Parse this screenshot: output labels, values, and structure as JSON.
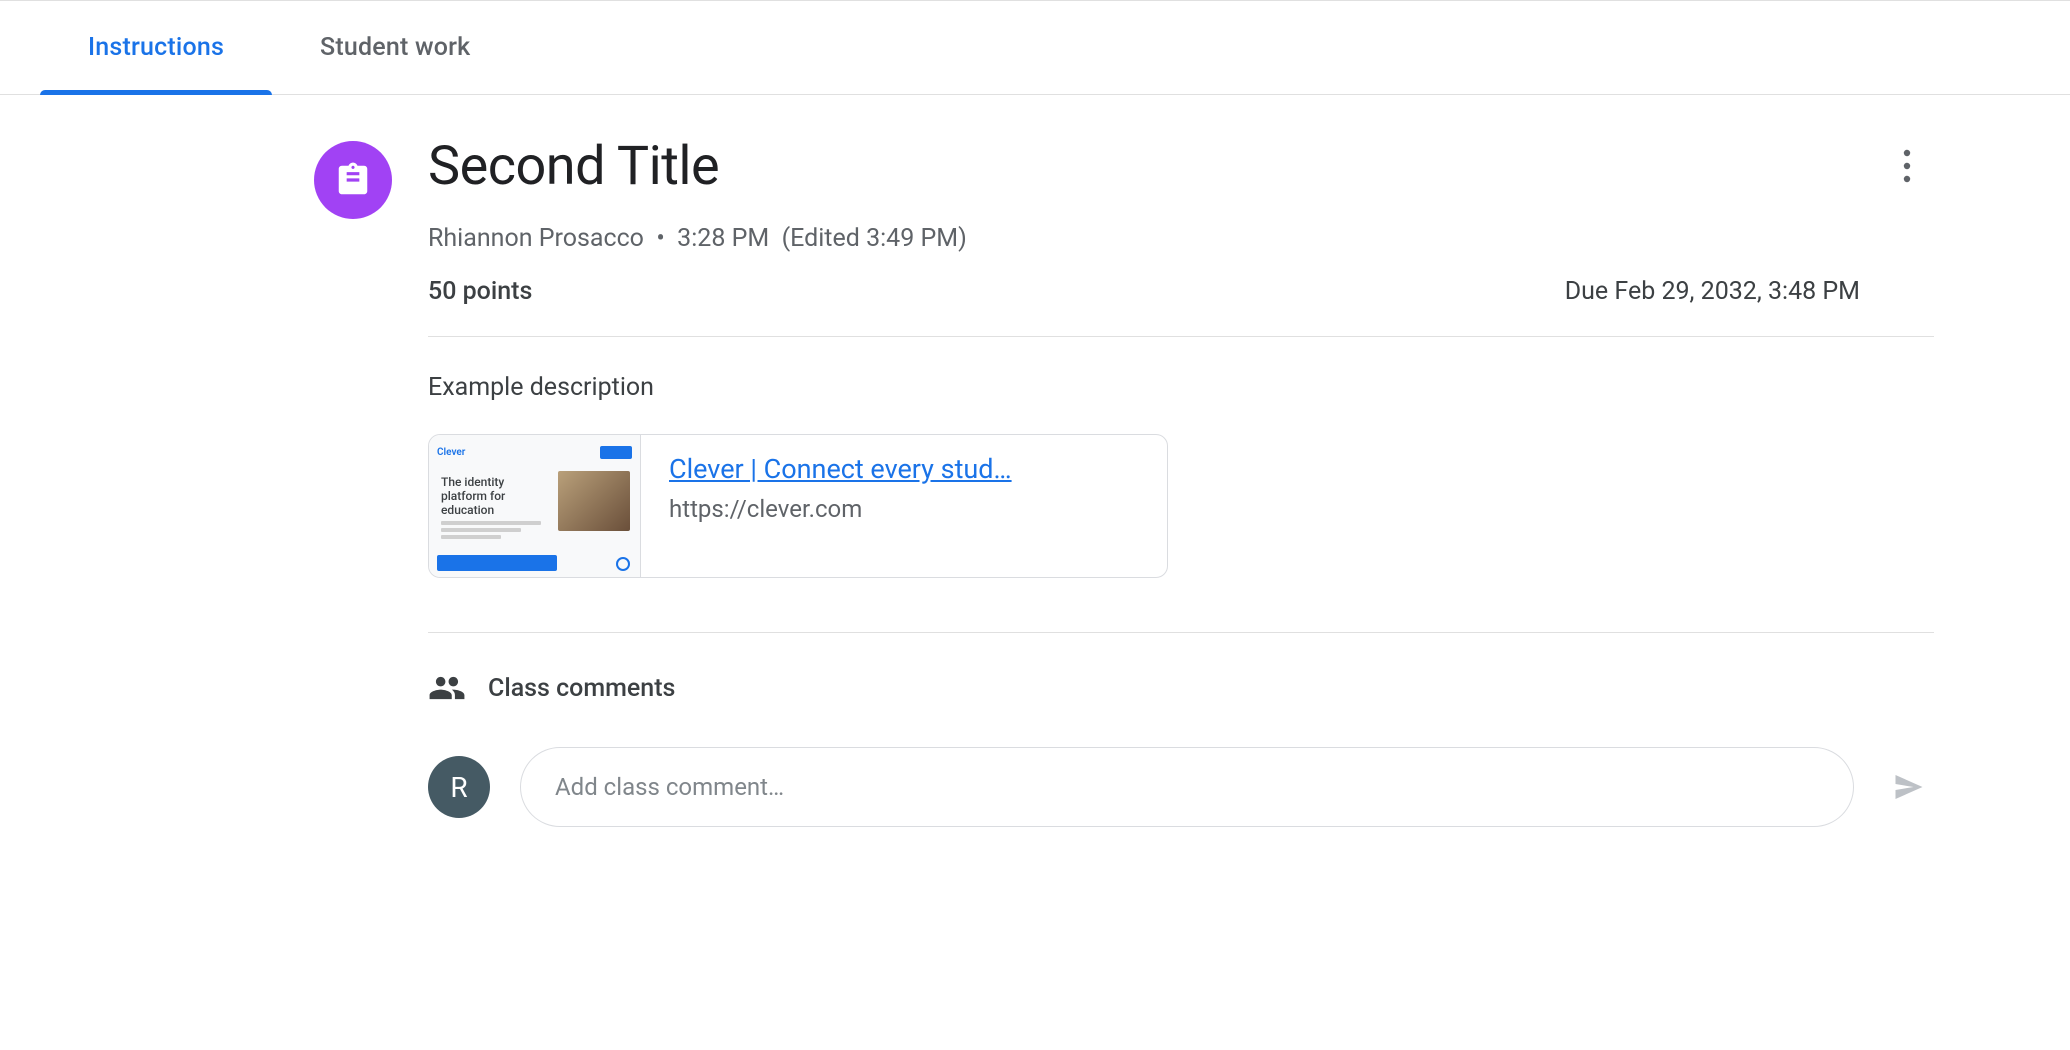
{
  "tabs": {
    "instructions": "Instructions",
    "student_work": "Student work"
  },
  "assignment": {
    "title": "Second Title",
    "author": "Rhiannon Prosacco",
    "posted_time": "3:28 PM",
    "edited_label": "Edited",
    "edited_time": "3:49 PM",
    "points": "50 points",
    "due": "Due Feb 29, 2032, 3:48 PM",
    "description": "Example description"
  },
  "attachment": {
    "title": "Clever | Connect every stud…",
    "url": "https://clever.com",
    "thumb_logo": "Clever",
    "thumb_headline": "The identity platform for education"
  },
  "comments": {
    "header": "Class comments",
    "placeholder": "Add class comment…",
    "avatar_initial": "R"
  }
}
